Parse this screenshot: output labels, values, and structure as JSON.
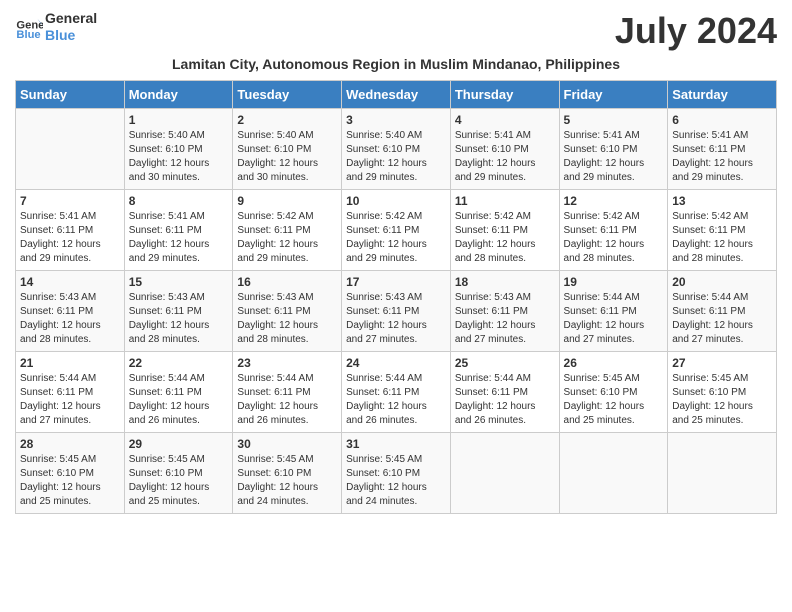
{
  "header": {
    "logo_line1": "General",
    "logo_line2": "Blue",
    "month_title": "July 2024",
    "subtitle": "Lamitan City, Autonomous Region in Muslim Mindanao, Philippines"
  },
  "days_of_week": [
    "Sunday",
    "Monday",
    "Tuesday",
    "Wednesday",
    "Thursday",
    "Friday",
    "Saturday"
  ],
  "weeks": [
    [
      {
        "day": "",
        "info": ""
      },
      {
        "day": "1",
        "info": "Sunrise: 5:40 AM\nSunset: 6:10 PM\nDaylight: 12 hours\nand 30 minutes."
      },
      {
        "day": "2",
        "info": "Sunrise: 5:40 AM\nSunset: 6:10 PM\nDaylight: 12 hours\nand 30 minutes."
      },
      {
        "day": "3",
        "info": "Sunrise: 5:40 AM\nSunset: 6:10 PM\nDaylight: 12 hours\nand 29 minutes."
      },
      {
        "day": "4",
        "info": "Sunrise: 5:41 AM\nSunset: 6:10 PM\nDaylight: 12 hours\nand 29 minutes."
      },
      {
        "day": "5",
        "info": "Sunrise: 5:41 AM\nSunset: 6:10 PM\nDaylight: 12 hours\nand 29 minutes."
      },
      {
        "day": "6",
        "info": "Sunrise: 5:41 AM\nSunset: 6:11 PM\nDaylight: 12 hours\nand 29 minutes."
      }
    ],
    [
      {
        "day": "7",
        "info": ""
      },
      {
        "day": "8",
        "info": "Sunrise: 5:41 AM\nSunset: 6:11 PM\nDaylight: 12 hours\nand 29 minutes."
      },
      {
        "day": "9",
        "info": "Sunrise: 5:42 AM\nSunset: 6:11 PM\nDaylight: 12 hours\nand 29 minutes."
      },
      {
        "day": "10",
        "info": "Sunrise: 5:42 AM\nSunset: 6:11 PM\nDaylight: 12 hours\nand 29 minutes."
      },
      {
        "day": "11",
        "info": "Sunrise: 5:42 AM\nSunset: 6:11 PM\nDaylight: 12 hours\nand 28 minutes."
      },
      {
        "day": "12",
        "info": "Sunrise: 5:42 AM\nSunset: 6:11 PM\nDaylight: 12 hours\nand 28 minutes."
      },
      {
        "day": "13",
        "info": "Sunrise: 5:42 AM\nSunset: 6:11 PM\nDaylight: 12 hours\nand 28 minutes."
      }
    ],
    [
      {
        "day": "14",
        "info": ""
      },
      {
        "day": "15",
        "info": "Sunrise: 5:43 AM\nSunset: 6:11 PM\nDaylight: 12 hours\nand 28 minutes."
      },
      {
        "day": "16",
        "info": "Sunrise: 5:43 AM\nSunset: 6:11 PM\nDaylight: 12 hours\nand 28 minutes."
      },
      {
        "day": "17",
        "info": "Sunrise: 5:43 AM\nSunset: 6:11 PM\nDaylight: 12 hours\nand 27 minutes."
      },
      {
        "day": "18",
        "info": "Sunrise: 5:43 AM\nSunset: 6:11 PM\nDaylight: 12 hours\nand 27 minutes."
      },
      {
        "day": "19",
        "info": "Sunrise: 5:44 AM\nSunset: 6:11 PM\nDaylight: 12 hours\nand 27 minutes."
      },
      {
        "day": "20",
        "info": "Sunrise: 5:44 AM\nSunset: 6:11 PM\nDaylight: 12 hours\nand 27 minutes."
      }
    ],
    [
      {
        "day": "21",
        "info": ""
      },
      {
        "day": "22",
        "info": "Sunrise: 5:44 AM\nSunset: 6:11 PM\nDaylight: 12 hours\nand 26 minutes."
      },
      {
        "day": "23",
        "info": "Sunrise: 5:44 AM\nSunset: 6:11 PM\nDaylight: 12 hours\nand 26 minutes."
      },
      {
        "day": "24",
        "info": "Sunrise: 5:44 AM\nSunset: 6:11 PM\nDaylight: 12 hours\nand 26 minutes."
      },
      {
        "day": "25",
        "info": "Sunrise: 5:44 AM\nSunset: 6:11 PM\nDaylight: 12 hours\nand 26 minutes."
      },
      {
        "day": "26",
        "info": "Sunrise: 5:45 AM\nSunset: 6:10 PM\nDaylight: 12 hours\nand 25 minutes."
      },
      {
        "day": "27",
        "info": "Sunrise: 5:45 AM\nSunset: 6:10 PM\nDaylight: 12 hours\nand 25 minutes."
      }
    ],
    [
      {
        "day": "28",
        "info": "Sunrise: 5:45 AM\nSunset: 6:10 PM\nDaylight: 12 hours\nand 25 minutes."
      },
      {
        "day": "29",
        "info": "Sunrise: 5:45 AM\nSunset: 6:10 PM\nDaylight: 12 hours\nand 25 minutes."
      },
      {
        "day": "30",
        "info": "Sunrise: 5:45 AM\nSunset: 6:10 PM\nDaylight: 12 hours\nand 24 minutes."
      },
      {
        "day": "31",
        "info": "Sunrise: 5:45 AM\nSunset: 6:10 PM\nDaylight: 12 hours\nand 24 minutes."
      },
      {
        "day": "",
        "info": ""
      },
      {
        "day": "",
        "info": ""
      },
      {
        "day": "",
        "info": ""
      }
    ]
  ],
  "week7_sunday_info": "Sunrise: 5:41 AM\nSunset: 6:11 PM\nDaylight: 12 hours\nand 29 minutes.",
  "week14_sunday_info": "Sunrise: 5:43 AM\nSunset: 6:11 PM\nDaylight: 12 hours\nand 28 minutes.",
  "week21_sunday_info": "Sunrise: 5:44 AM\nSunset: 6:11 PM\nDaylight: 12 hours\nand 27 minutes."
}
